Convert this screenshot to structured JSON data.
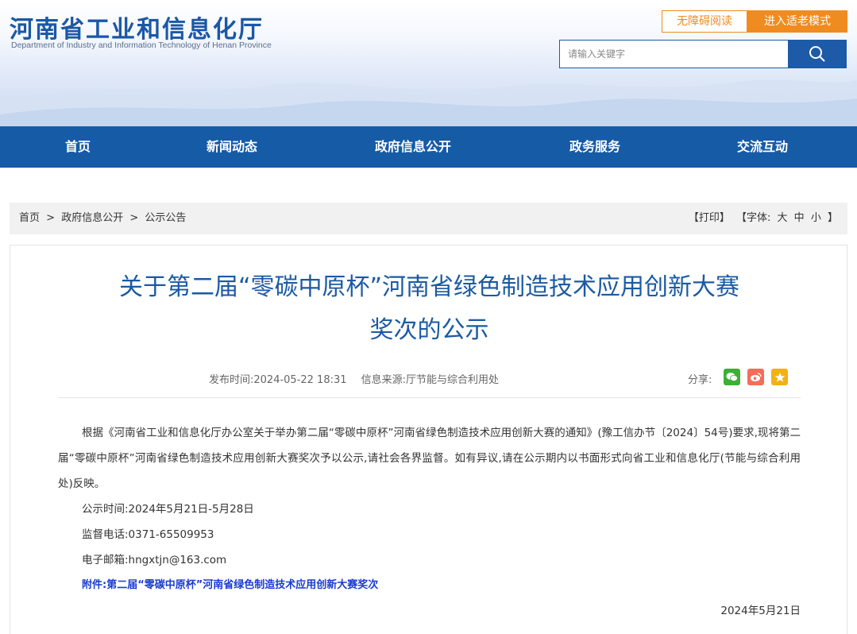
{
  "header": {
    "site_title": "河南省工业和信息化厅",
    "site_subtitle": "Department of Industry and Information Technology of Henan Province",
    "accessible_label": "无障碍阅读",
    "elder_mode_label": "进入适老模式",
    "search_placeholder": "请输入关键字",
    "search_icon": "search-icon"
  },
  "nav": {
    "items": [
      {
        "label": "首页"
      },
      {
        "label": "新闻动态"
      },
      {
        "label": "政府信息公开"
      },
      {
        "label": "政务服务"
      },
      {
        "label": "交流互动"
      }
    ]
  },
  "breadcrumb": {
    "items": [
      "首页",
      ">",
      "政府信息公开",
      ">",
      "公示公告"
    ],
    "tools": {
      "print": "【打印】",
      "font_label": "【字体:",
      "large": "大",
      "medium": "中",
      "small": "小",
      "close": "】"
    }
  },
  "article": {
    "title_line1": "关于第二届“零碳中原杯”河南省绿色制造技术应用创新大赛",
    "title_line2": "奖次的公示",
    "publish_time": "发布时间:2024-05-22 18:31",
    "source": "信息来源:厅节能与综合利用处",
    "share_label": "分享:",
    "share_icons": [
      "wechat-icon",
      "weibo-icon",
      "favorite-icon"
    ],
    "paragraph": "根据《河南省工业和信息化厅办公室关于举办第二届“零碳中原杯”河南省绿色制造技术应用创新大赛的通知》(豫工信办节〔2024〕54号)要求,现将第二届“零碳中原杯”河南省绿色制造技术应用创新大赛奖次予以公示,请社会各界监督。如有异议,请在公示期内以书面形式向省工业和信息化厅(节能与综合利用处)反映。",
    "notice_period": "公示时间:2024年5月21日-5月28日",
    "phone": "监督电话:0371-65509953",
    "email": "电子邮箱:hngxtjn@163.com",
    "attachment": "附件:第二届“零碳中原杯”河南省绿色制造技术应用创新大赛奖次",
    "sign_date": "2024年5月21日"
  },
  "colors": {
    "brand_blue": "#165ba6",
    "title_blue": "#1b5aa3",
    "accent_orange": "#f08b1f",
    "link_blue": "#1a3bd1"
  }
}
